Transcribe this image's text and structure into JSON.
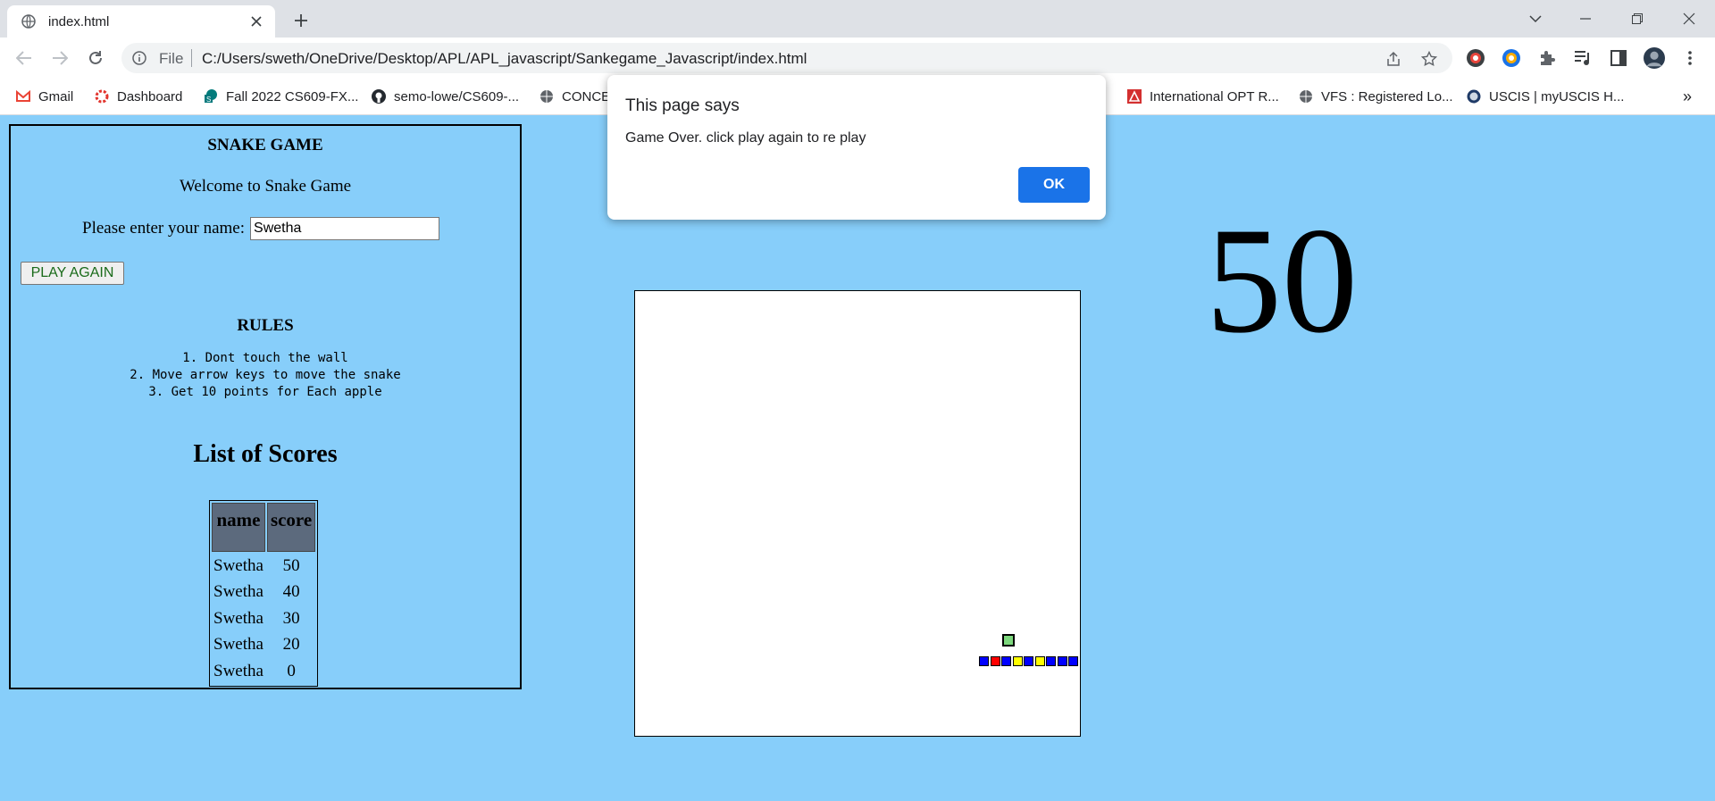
{
  "browser": {
    "tab_title": "index.html",
    "address_scheme": "File",
    "address_url": "C:/Users/sweth/OneDrive/Desktop/APL/APL_javascript/Sankegame_Javascript/index.html",
    "bookmarks": [
      "Gmail",
      "Dashboard",
      "Fall 2022 CS609-FX...",
      "semo-lowe/CS609-...",
      "CONCE",
      "International OPT R...",
      "VFS : Registered Lo...",
      "USCIS | myUSCIS H..."
    ],
    "overflow": "»"
  },
  "page": {
    "game_title": "SNAKE GAME",
    "welcome": "Welcome to Snake Game",
    "name_label": "Please enter your name:",
    "name_value": "Swetha",
    "play_again": "PLAY AGAIN",
    "rules_title": "RULES",
    "rules": [
      "1. Dont touch the wall",
      "2. Move arrow keys to move the snake",
      "3. Get 10 points for Each apple"
    ],
    "scores_title": "List of Scores",
    "score_headers": [
      "name",
      "score"
    ],
    "scores": [
      {
        "name": "Swetha",
        "score": "50"
      },
      {
        "name": "Swetha",
        "score": "40"
      },
      {
        "name": "Swetha",
        "score": "30"
      },
      {
        "name": "Swetha",
        "score": "20"
      },
      {
        "name": "Swetha",
        "score": "0"
      }
    ],
    "current_score": "50",
    "snake_colors": [
      "blue",
      "red",
      "blue",
      "yellow",
      "blue",
      "yellow",
      "blue",
      "blue",
      "blue"
    ]
  },
  "dialog": {
    "title": "This page says",
    "message": "Game Over. click play again to re play",
    "ok": "OK"
  },
  "colors": {
    "page_bg": "#87cefa",
    "header_cell": "#5c6a7d",
    "ok_button": "#1a73e8",
    "apple": "#7dd87d"
  }
}
